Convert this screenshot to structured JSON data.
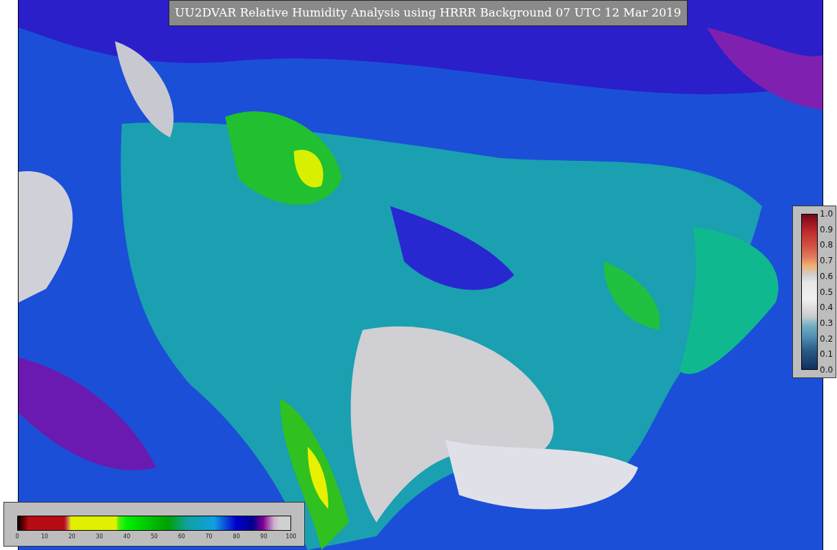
{
  "title": "UU2DVAR Relative Humidity Analysis using HRRR Background 07 UTC 12 Mar 2019",
  "bottom_colorbar": {
    "ticks": [
      "0",
      "10",
      "20",
      "30",
      "40",
      "50",
      "60",
      "70",
      "80",
      "90",
      "100"
    ]
  },
  "right_colorbar": {
    "ticks": [
      "1.0",
      "0.9",
      "0.8",
      "0.7",
      "0.6",
      "0.5",
      "0.4",
      "0.3",
      "0.2",
      "0.1",
      "0.0"
    ]
  }
}
